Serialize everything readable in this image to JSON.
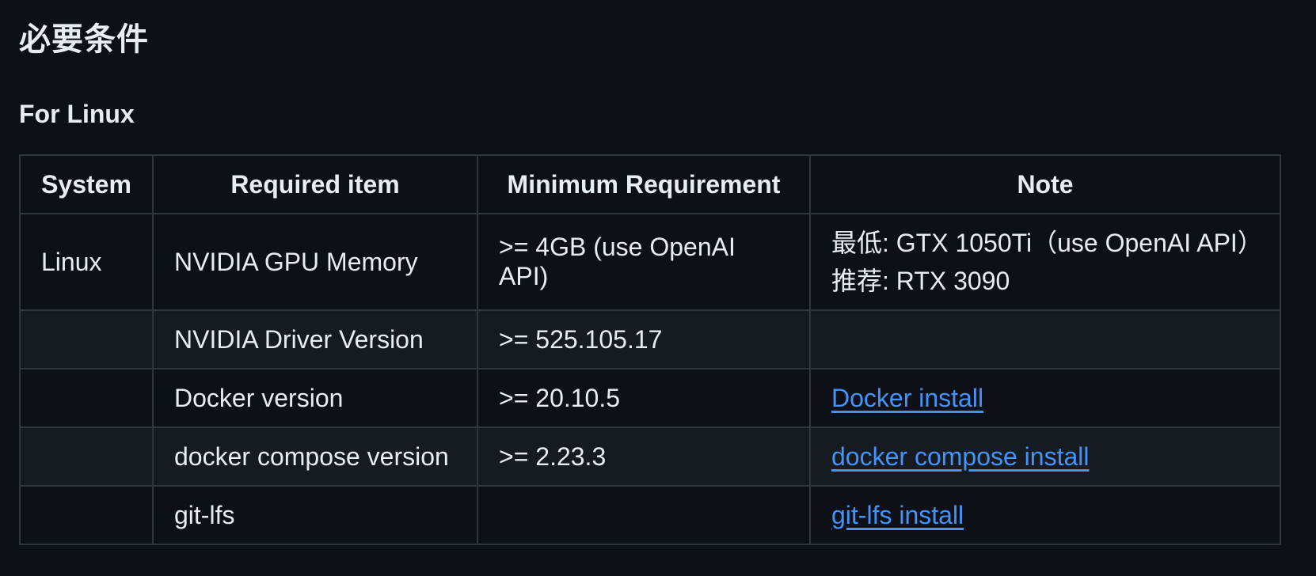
{
  "heading": "必要条件",
  "subheading": "For Linux",
  "table": {
    "headers": [
      "System",
      "Required item",
      "Minimum Requirement",
      "Note"
    ],
    "rows": [
      {
        "system": "Linux",
        "item": "NVIDIA GPU Memory",
        "minimum": ">= 4GB (use OpenAI API)",
        "note_lines": [
          "最低: GTX 1050Ti（use OpenAI API）",
          "推荐: RTX 3090"
        ],
        "note_link": ""
      },
      {
        "system": "",
        "item": "NVIDIA Driver Version",
        "minimum": ">= 525.105.17",
        "note_lines": [],
        "note_link": ""
      },
      {
        "system": "",
        "item": "Docker version",
        "minimum": ">= 20.10.5",
        "note_lines": [],
        "note_link": "Docker install"
      },
      {
        "system": "",
        "item": "docker compose version",
        "minimum": ">= 2.23.3",
        "note_lines": [],
        "note_link": "docker compose install"
      },
      {
        "system": "",
        "item": "git-lfs",
        "minimum": "",
        "note_lines": [],
        "note_link": "git-lfs install"
      }
    ]
  },
  "colors": {
    "background": "#0d1117",
    "text": "#e6edf3",
    "border": "#30363d",
    "alt_row": "#161b22",
    "link": "#4493f8"
  }
}
